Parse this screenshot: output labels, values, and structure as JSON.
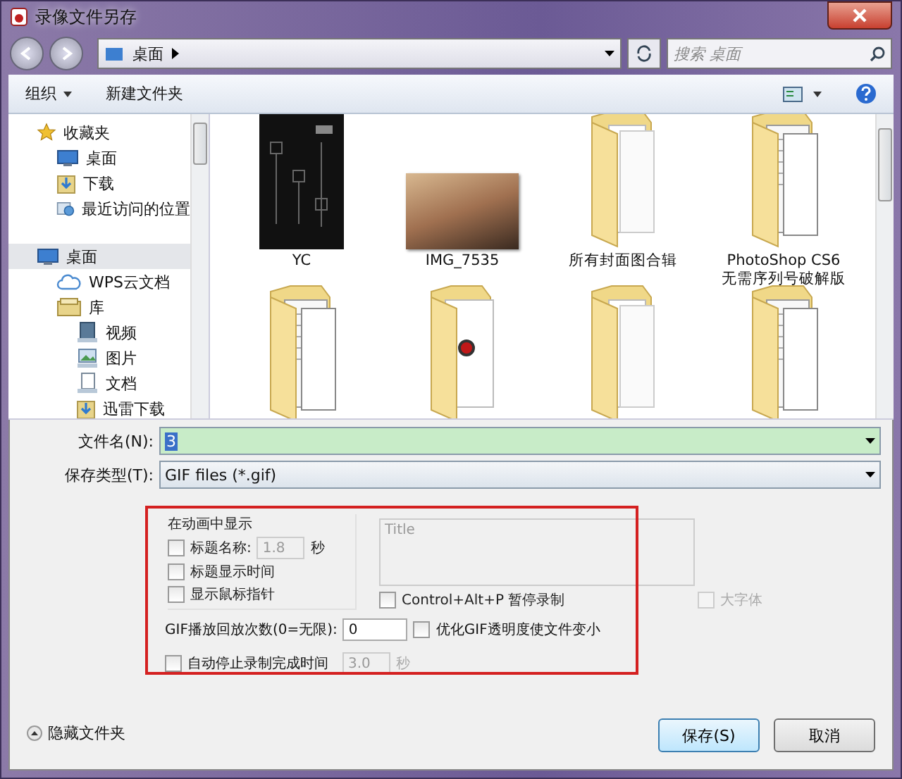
{
  "window": {
    "title": "录像文件另存"
  },
  "nav": {
    "path": "桌面",
    "search_placeholder": "搜索 桌面"
  },
  "toolbar": {
    "items": [
      {
        "label": "组织",
        "kind": "menu"
      },
      {
        "label": "新建文件夹",
        "kind": "plain"
      }
    ]
  },
  "sidebar": {
    "items": [
      {
        "label": "收藏夹",
        "kind": "star",
        "selected": false,
        "children": [
          {
            "label": "桌面",
            "kind": "desktop",
            "selected": false
          },
          {
            "label": "下载",
            "kind": "download",
            "selected": false
          },
          {
            "label": "最近访问的位置",
            "kind": "recent",
            "selected": false
          }
        ]
      },
      {
        "label": "桌面",
        "kind": "desktop",
        "selected": true,
        "children": [
          {
            "label": "WPS云文档",
            "kind": "cloud",
            "selected": false
          },
          {
            "label": "库",
            "kind": "library",
            "selected": false,
            "children": [
              {
                "label": "视频",
                "kind": "video",
                "selected": false
              },
              {
                "label": "图片",
                "kind": "picture",
                "selected": false
              },
              {
                "label": "文档",
                "kind": "document",
                "selected": false
              },
              {
                "label": "迅雷下载",
                "kind": "download",
                "selected": false
              }
            ]
          }
        ]
      }
    ]
  },
  "files": [
    {
      "name": "YC",
      "kind": "dark-image"
    },
    {
      "name": "IMG_7535",
      "kind": "photo"
    },
    {
      "name": "所有封面图合辑",
      "kind": "folder"
    },
    {
      "name": "PhotoShop CS6 无需序列号破解版",
      "kind": "folder-docs"
    },
    {
      "kind": "folder-docs"
    },
    {
      "kind": "folder-record"
    },
    {
      "kind": "folder"
    },
    {
      "kind": "folder-docs"
    }
  ],
  "save": {
    "filename_label": "文件名(N):",
    "filename": "3",
    "type_label": "保存类型(T):",
    "type": "GIF files (*.gif)"
  },
  "options": {
    "group_title": "在动画中显示",
    "checks": [
      {
        "label": "标题名称:",
        "checked": false
      },
      {
        "label": "标题显示时间",
        "checked": false
      },
      {
        "label": "显示鼠标指针",
        "checked": false
      }
    ],
    "title_duration": {
      "value": "1.8",
      "disabled": true,
      "unit": "秒"
    },
    "title_text": {
      "placeholder": "Title"
    },
    "pause_hotkey": {
      "label": "Control+Alt+P 暂停录制",
      "checked": false,
      "disabled": false
    },
    "large_font": {
      "label": "大字体",
      "checked": false,
      "disabled": true
    },
    "loop_label": "GIF播放回放次数(0=无限):",
    "loop_value": "0",
    "optimize": {
      "label": "优化GIF透明度使文件变小",
      "checked": false,
      "disabled": false
    },
    "auto_stop": {
      "label": "自动停止录制完成时间",
      "checked": false,
      "disabled": false
    },
    "auto_stop_value": {
      "value": "3.0",
      "disabled": true,
      "unit": "秒"
    }
  },
  "footer": {
    "toggle": "隐藏文件夹",
    "buttons": [
      "保存(S)",
      "取消"
    ]
  }
}
